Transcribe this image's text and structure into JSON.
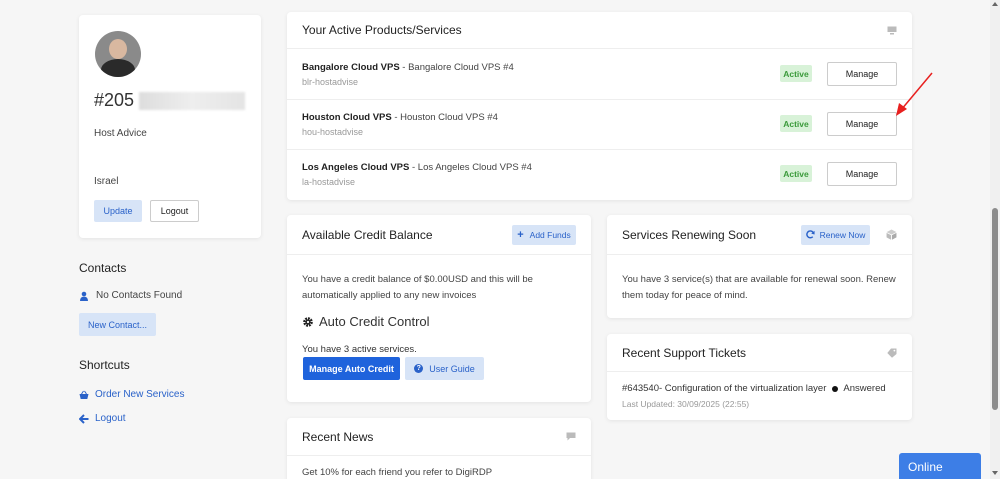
{
  "profile": {
    "id_prefix": "#205",
    "company": "Host Advice",
    "country": "Israel",
    "update_label": "Update",
    "logout_label": "Logout"
  },
  "contacts": {
    "heading": "Contacts",
    "empty_text": "No Contacts Found",
    "new_button": "New Contact..."
  },
  "shortcuts": {
    "heading": "Shortcuts",
    "items": [
      {
        "label": "Order New Services",
        "icon": "basket-icon"
      },
      {
        "label": "Logout",
        "icon": "arrow-left-icon"
      }
    ]
  },
  "products": {
    "title": "Your Active Products/Services",
    "manage_label": "Manage",
    "rows": [
      {
        "name": "Bangalore Cloud VPS",
        "detail": " - Bangalore Cloud VPS #4",
        "host": "blr-hostadvise",
        "status": "Active"
      },
      {
        "name": "Houston Cloud VPS",
        "detail": " - Houston Cloud VPS #4",
        "host": "hou-hostadvise",
        "status": "Active"
      },
      {
        "name": "Los Angeles Cloud VPS",
        "detail": " - Los Angeles Cloud VPS #4",
        "host": "la-hostadvise",
        "status": "Active"
      }
    ]
  },
  "credit": {
    "title": "Available Credit Balance",
    "add_funds": "Add Funds",
    "text": "You have a credit balance of $0.00USD and this will be automatically applied to any new invoices",
    "auto_title": "Auto Credit Control",
    "active_text": "You have 3 active services.",
    "manage_btn": "Manage Auto Credit",
    "guide_btn": "User Guide"
  },
  "renewing": {
    "title": "Services Renewing Soon",
    "renew_btn": "Renew Now",
    "text": "You have 3 service(s) that are available for renewal soon. Renew them today for peace of mind."
  },
  "tickets": {
    "title": "Recent Support Tickets",
    "ticket_id": "#643540",
    "ticket_subject": " - Configuration of the virtualization layer",
    "ticket_status": "Answered",
    "updated": "Last Updated: 30/09/2025 (22:55)"
  },
  "news": {
    "title": "Recent News",
    "item": "Get 10% for each friend you refer to DigiRDP"
  },
  "chat": {
    "label": "Online"
  },
  "colors": {
    "primary": "#1f63dc",
    "active_badge": "#d8f2d8",
    "arrow": "#e8201f"
  }
}
